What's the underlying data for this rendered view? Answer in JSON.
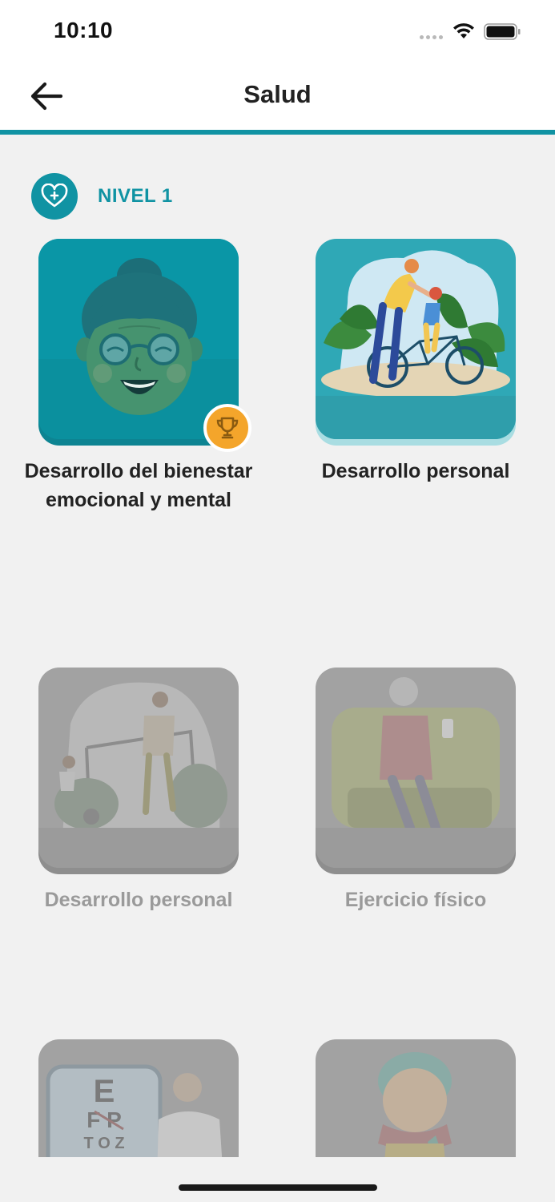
{
  "status_bar": {
    "time": "10:10"
  },
  "header": {
    "title": "Salud"
  },
  "level": {
    "label": "NIVEL 1"
  },
  "cards": [
    {
      "title": "Desarrollo del bienestar emocional y mental",
      "completed": true,
      "locked": false,
      "image": "grandmother-illustration"
    },
    {
      "title": "Desarrollo personal",
      "completed": false,
      "locked": false,
      "image": "bicycle-illustration"
    },
    {
      "title": "Desarrollo personal",
      "completed": false,
      "locked": true,
      "image": "soccer-illustration"
    },
    {
      "title": "Ejercicio físico",
      "completed": false,
      "locked": true,
      "image": "armchair-illustration"
    },
    {
      "title": "",
      "completed": false,
      "locked": true,
      "image": "eye-chart-illustration"
    },
    {
      "title": "",
      "completed": false,
      "locked": true,
      "image": "winter-child-illustration"
    }
  ],
  "eye_chart": {
    "row1": "E",
    "row2": "F P",
    "row3": "T O Z"
  },
  "colors": {
    "primary": "#1093a3",
    "trophy": "#f4a52b",
    "locked": "#a3a3a3",
    "background": "#f1f1f1"
  }
}
